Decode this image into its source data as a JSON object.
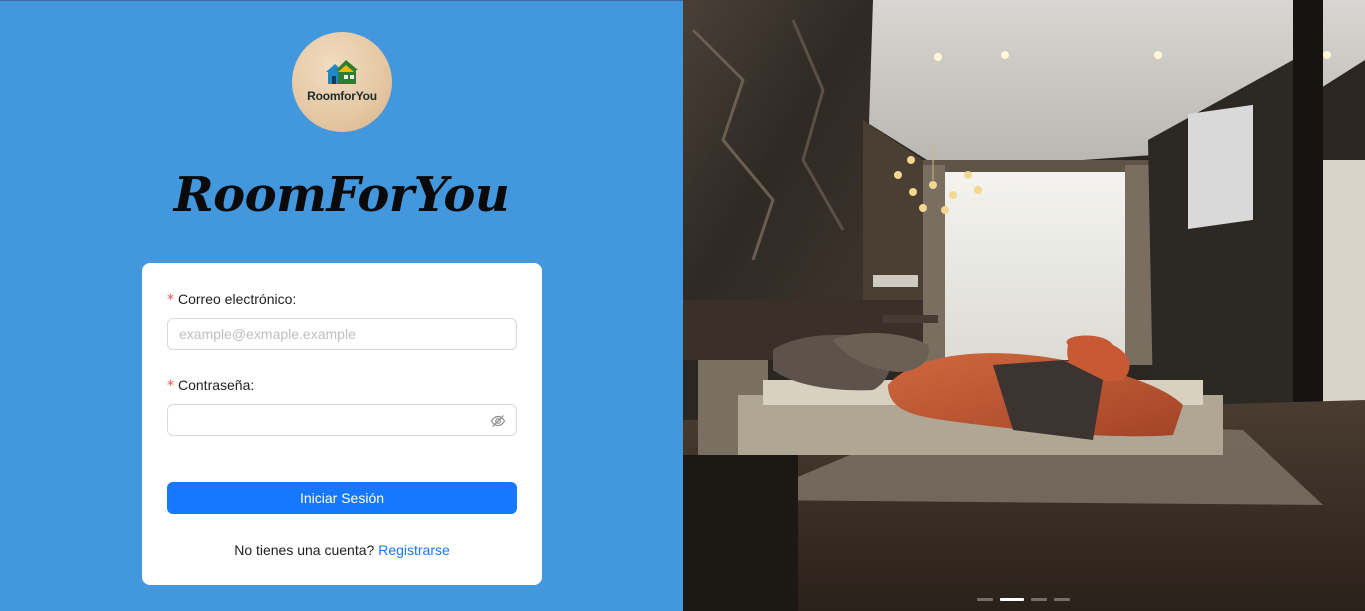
{
  "brand": {
    "logo_text": "RoomforYou",
    "title": "RoomForYou"
  },
  "login_form": {
    "email_label": "Correo electrónico:",
    "email_placeholder": "example@exmaple.example",
    "email_value": "",
    "password_label": "Contraseña:",
    "password_value": "",
    "required_mark": "*",
    "submit_label": "Iniciar Sesión",
    "no_account_text": "No tienes una cuenta?",
    "register_link": "Registrarse"
  },
  "carousel": {
    "slide_count": 4,
    "active_index": 1
  },
  "colors": {
    "left_panel_bg": "#4397dd",
    "primary": "#1677ff",
    "required": "#ff4d4f"
  },
  "icons": [
    "eye-invisible-icon",
    "house-logo-icon"
  ]
}
